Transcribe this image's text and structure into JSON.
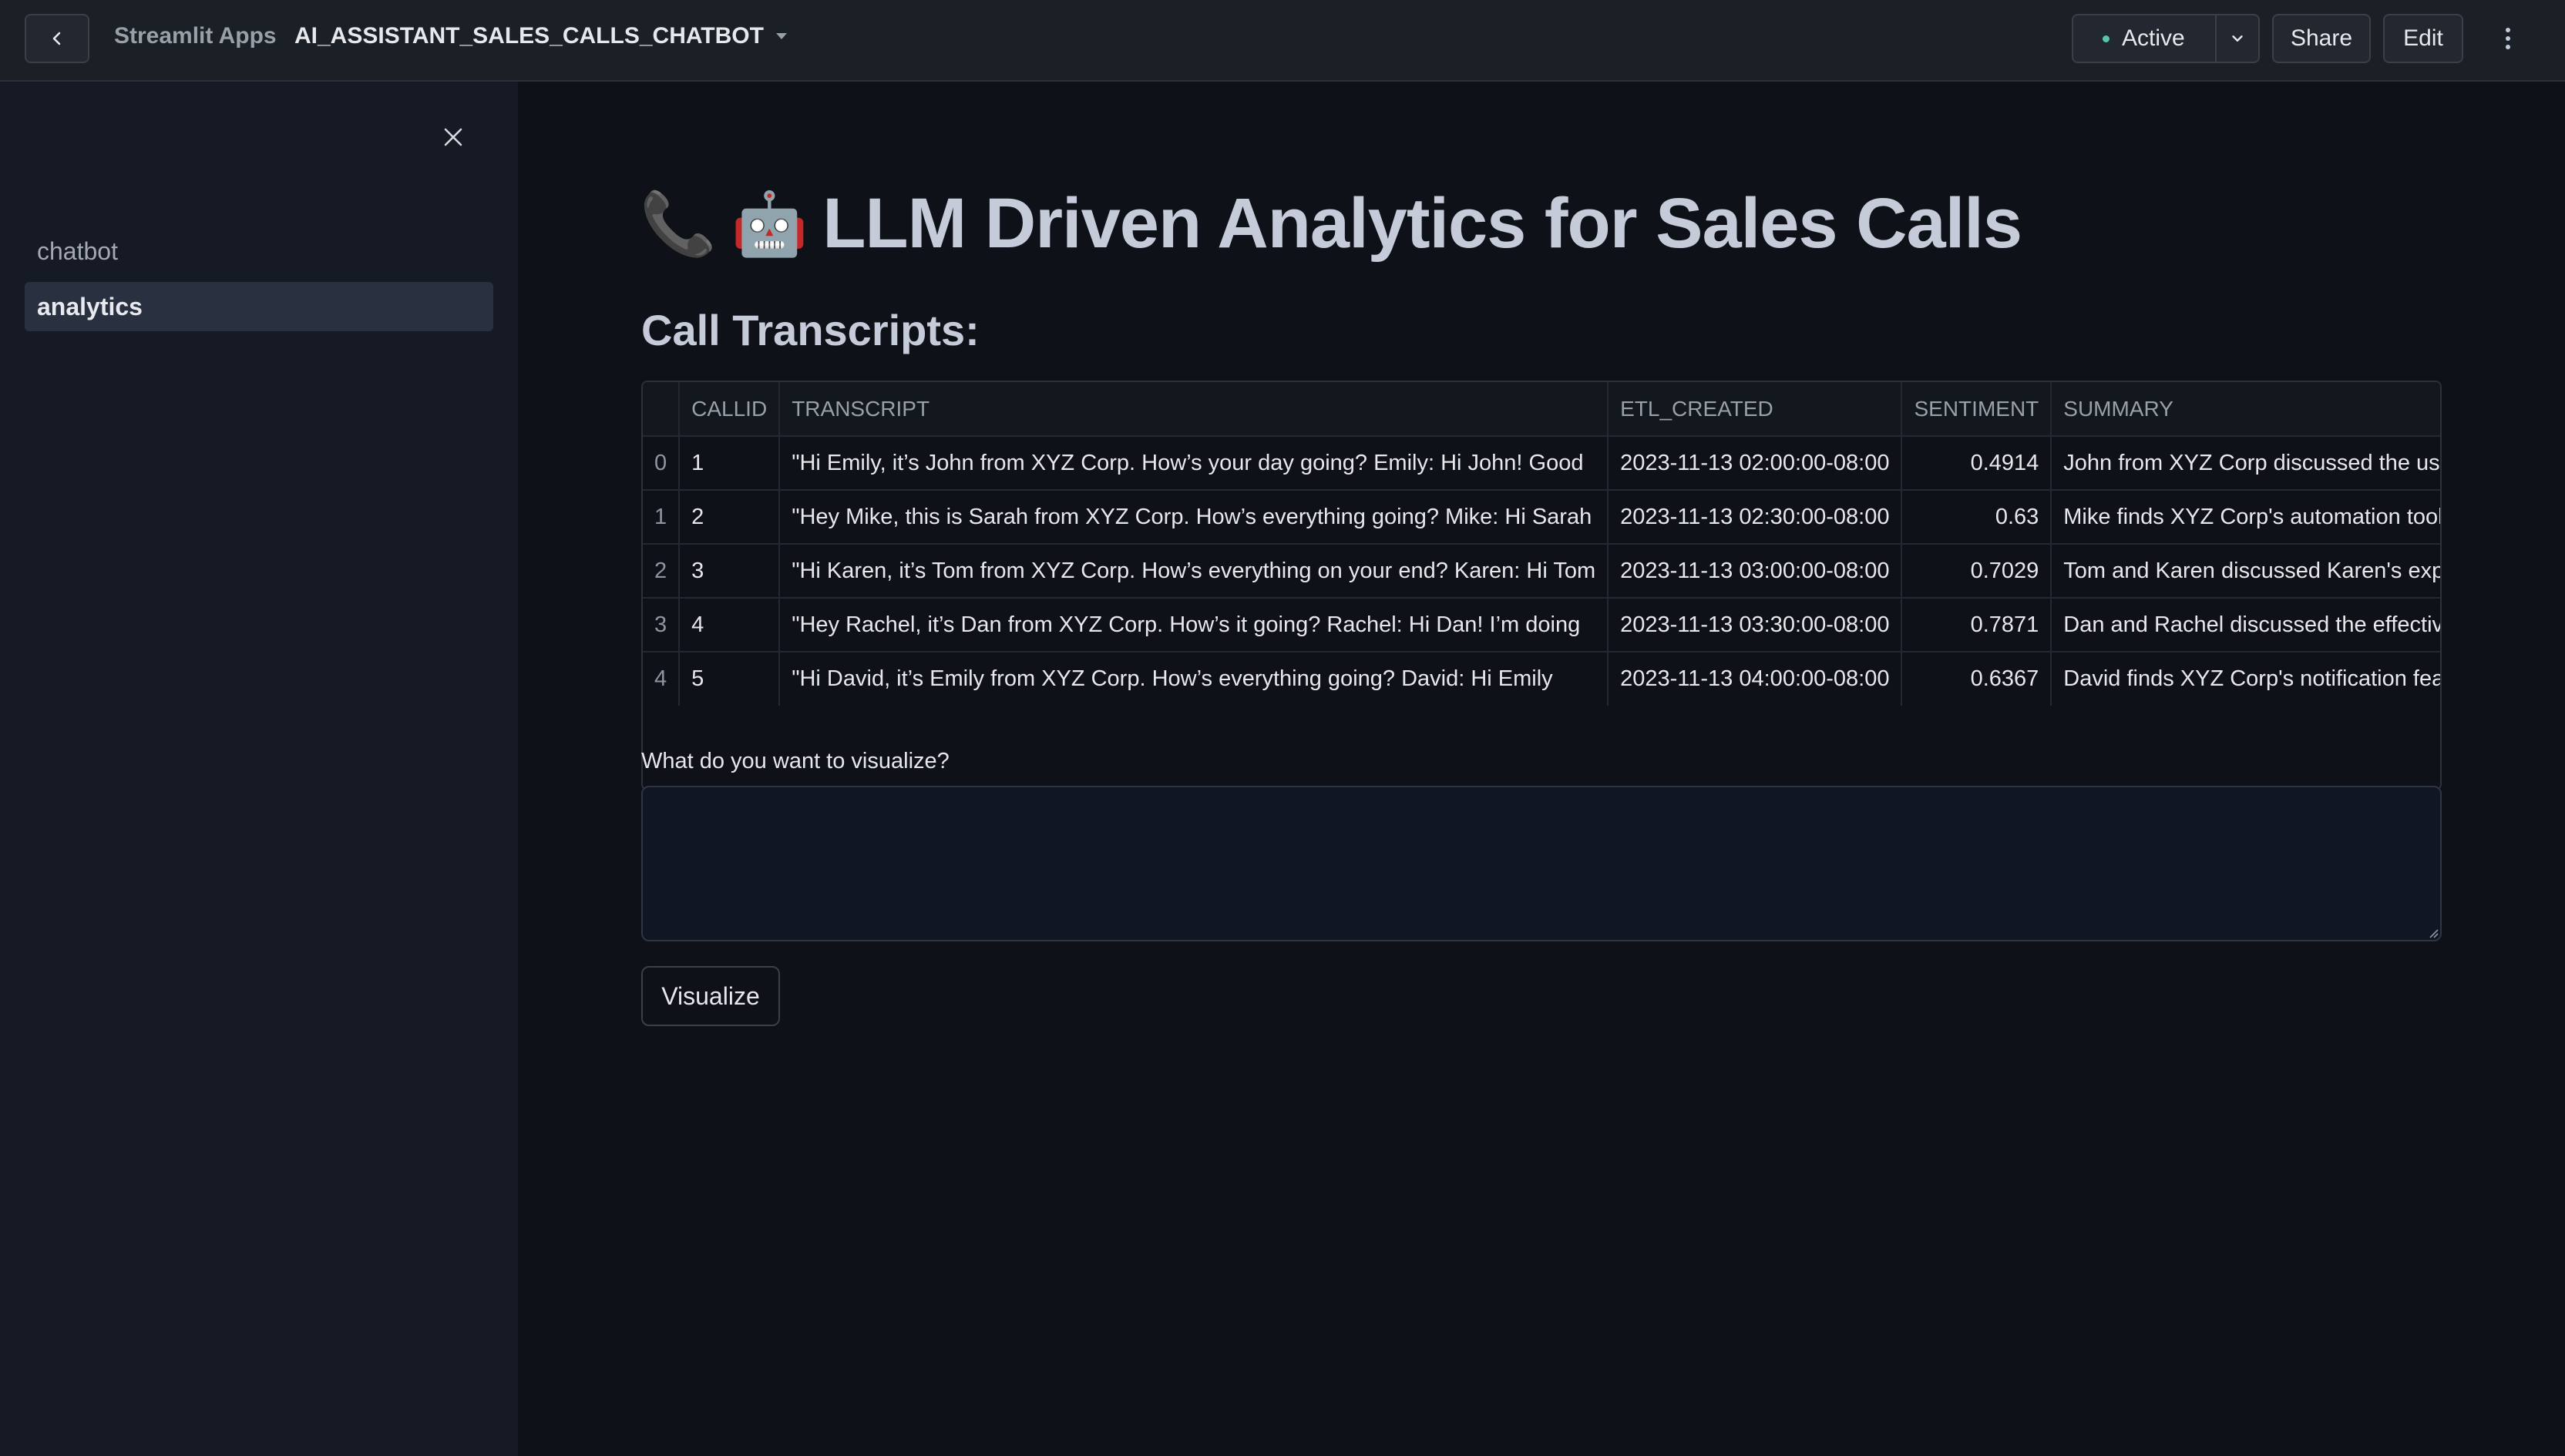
{
  "topbar": {
    "back_icon": "chevron-left-icon",
    "breadcrumb": "Streamlit Apps",
    "app_name": "AI_ASSISTANT_SALES_CALLS_CHATBOT",
    "status": "Active",
    "status_color": "#58c4a8",
    "share_label": "Share",
    "edit_label": "Edit",
    "more_icon": "kebab-vertical-icon"
  },
  "sidebar": {
    "close_icon": "close-icon",
    "items": [
      {
        "label": "chatbot",
        "active": false
      },
      {
        "label": "analytics",
        "active": true
      }
    ]
  },
  "main": {
    "title_emoji_1": "📞",
    "title_emoji_2": "🤖",
    "title": "LLM Driven Analytics for Sales Calls",
    "section_title": "Call Transcripts:",
    "table": {
      "columns": [
        "",
        "CALLID",
        "TRANSCRIPT",
        "ETL_CREATED",
        "SENTIMENT",
        "SUMMARY"
      ],
      "rows": [
        {
          "index": "0",
          "callid": "1",
          "transcript": "\"Hi Emily, it’s John from XYZ Corp. How’s your day going? Emily: Hi John! Good",
          "etl_created": "2023-11-13 02:00:00-08:00",
          "sentiment": "0.4914",
          "summary": "John from XYZ Corp discussed the use"
        },
        {
          "index": "1",
          "callid": "2",
          "transcript": "\"Hey Mike, this is Sarah from XYZ Corp. How’s everything going? Mike: Hi Sarah",
          "etl_created": "2023-11-13 02:30:00-08:00",
          "sentiment": "0.63",
          "summary": "Mike finds XYZ Corp's automation tools"
        },
        {
          "index": "2",
          "callid": "3",
          "transcript": "\"Hi Karen, it’s Tom from XYZ Corp. How’s everything on your end? Karen: Hi Tom",
          "etl_created": "2023-11-13 03:00:00-08:00",
          "sentiment": "0.7029",
          "summary": "Tom and Karen discussed Karen's experience"
        },
        {
          "index": "3",
          "callid": "4",
          "transcript": "\"Hey Rachel, it’s Dan from XYZ Corp. How’s it going? Rachel: Hi Dan! I’m doing",
          "etl_created": "2023-11-13 03:30:00-08:00",
          "sentiment": "0.7871",
          "summary": "Dan and Rachel discussed the effectiveness"
        },
        {
          "index": "4",
          "callid": "5",
          "transcript": "\"Hi David, it’s Emily from XYZ Corp. How’s everything going? David: Hi Emily",
          "etl_created": "2023-11-13 04:00:00-08:00",
          "sentiment": "0.6367",
          "summary": "David finds XYZ Corp's notification features"
        }
      ]
    },
    "viz_label": "What do you want to visualize?",
    "viz_value": "",
    "viz_button": "Visualize"
  }
}
